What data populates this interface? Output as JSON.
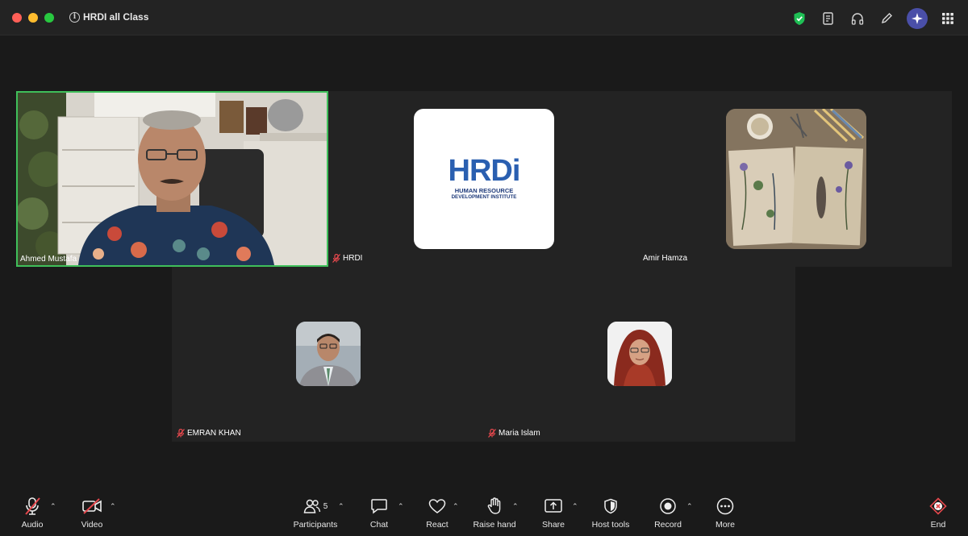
{
  "meeting": {
    "title": "HRDI all Class"
  },
  "participants": [
    {
      "name": "Ahmed Mustafa",
      "muted": false
    },
    {
      "name": "HRDI",
      "muted": true,
      "logo_main": "HRDi",
      "logo_sub1": "HUMAN RESOURCE",
      "logo_sub2": "DEVELOPMENT INSTITUTE"
    },
    {
      "name": "Amir Hamza",
      "muted": false
    },
    {
      "name": "EMRAN KHAN",
      "muted": true
    },
    {
      "name": "Maria Islam",
      "muted": true
    }
  ],
  "toolbar": {
    "audio": "Audio",
    "video": "Video",
    "participants": "Participants",
    "participants_count": "5",
    "chat": "Chat",
    "react": "React",
    "raise_hand": "Raise hand",
    "share": "Share",
    "host_tools": "Host tools",
    "record": "Record",
    "more": "More",
    "end": "End"
  },
  "colors": {
    "active_speaker_border": "#3fbf5a",
    "end_red": "#e5484d",
    "ai_accent": "#4a4fa8",
    "shield_green": "#1fbf55"
  },
  "icons": [
    "info-icon",
    "shield-icon",
    "notes-icon",
    "headphones-icon",
    "pencil-icon",
    "ai-companion-icon",
    "apps-grid-icon",
    "muted-mic-icon"
  ]
}
